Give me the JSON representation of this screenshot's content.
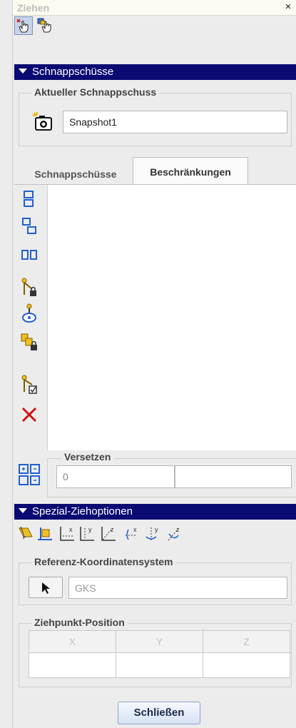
{
  "window": {
    "title": "Ziehen",
    "close_glyph": "×"
  },
  "mode_buttons": [
    {
      "icon": "drag-point-icon"
    },
    {
      "icon": "drag-body-icon"
    }
  ],
  "snapshots": {
    "header": "Schnappschüsse",
    "current_group_label": "Aktueller Schnappschuss",
    "camera_icon": "camera-icon",
    "name_value": "Snapshot1"
  },
  "tabs": [
    {
      "label": "Schnappschüsse",
      "active": false
    },
    {
      "label": "Beschränkungen",
      "active": true
    }
  ],
  "constraint_tools": [
    "align-icon",
    "offset-icon",
    "parallel-icon",
    "lock-body-icon",
    "motor-icon",
    "assembly-lock-icon",
    "enable-constraint-icon",
    "delete-icon"
  ],
  "offset": {
    "label": "Versetzen",
    "value": "0",
    "value2": "",
    "icon": "offset-grid-icon"
  },
  "drag_options": {
    "header": "Spezial-Ziehoptionen",
    "icons": [
      "plane-drag-icon",
      "normal-drag-icon",
      "x-axis-icon",
      "y-axis-icon",
      "z-axis-icon",
      "x-rotation-icon",
      "y-rotation-icon",
      "z-rotation-icon"
    ],
    "ref_cs_label": "Referenz-Koordinatensystem",
    "ref_cs_select_icon": "cursor-arrow-icon",
    "ref_cs_value": "GKS",
    "drag_point_label": "Ziehpunkt-Position",
    "columns": [
      "X",
      "Y",
      "Z"
    ],
    "values": [
      "",
      "",
      ""
    ]
  },
  "close_button": "Schließen",
  "colors": {
    "section_header": "#0a0a73",
    "accent_blue": "#3a6ec8",
    "delete_red": "#d01010"
  }
}
